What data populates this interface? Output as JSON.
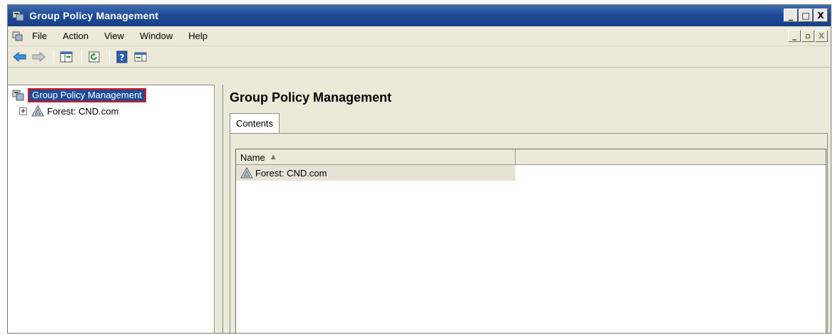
{
  "window": {
    "title": "Group Policy Management",
    "controls": {
      "minimize": "_",
      "maximize": "□",
      "close": "X"
    }
  },
  "menubar": {
    "items": [
      "File",
      "Action",
      "View",
      "Window",
      "Help"
    ],
    "mdi_controls": {
      "minimize": "_",
      "restore": "▫",
      "close": "X"
    }
  },
  "toolbar": {
    "buttons": [
      "back-arrow-icon",
      "forward-arrow-icon",
      "show-hide-console-tree-icon",
      "refresh-icon",
      "help-icon",
      "action-pane-icon"
    ]
  },
  "tree": {
    "root": {
      "label": "Group Policy Management",
      "icon": "gpm-icon",
      "selected": true
    },
    "children": [
      {
        "label": "Forest: CND.com",
        "icon": "forest-icon",
        "expander": "+"
      }
    ]
  },
  "main": {
    "title": "Group Policy Management",
    "tabs": [
      {
        "label": "Contents",
        "active": true
      }
    ],
    "list": {
      "columns": [
        {
          "label": "Name",
          "sort": "ascending"
        },
        {
          "label": ""
        }
      ],
      "rows": [
        {
          "name": "Forest: CND.com",
          "icon": "forest-icon"
        }
      ]
    }
  },
  "colors": {
    "titlebar": "#1f4c99",
    "selection_border": "#e01010",
    "chrome": "#ece9d8"
  }
}
